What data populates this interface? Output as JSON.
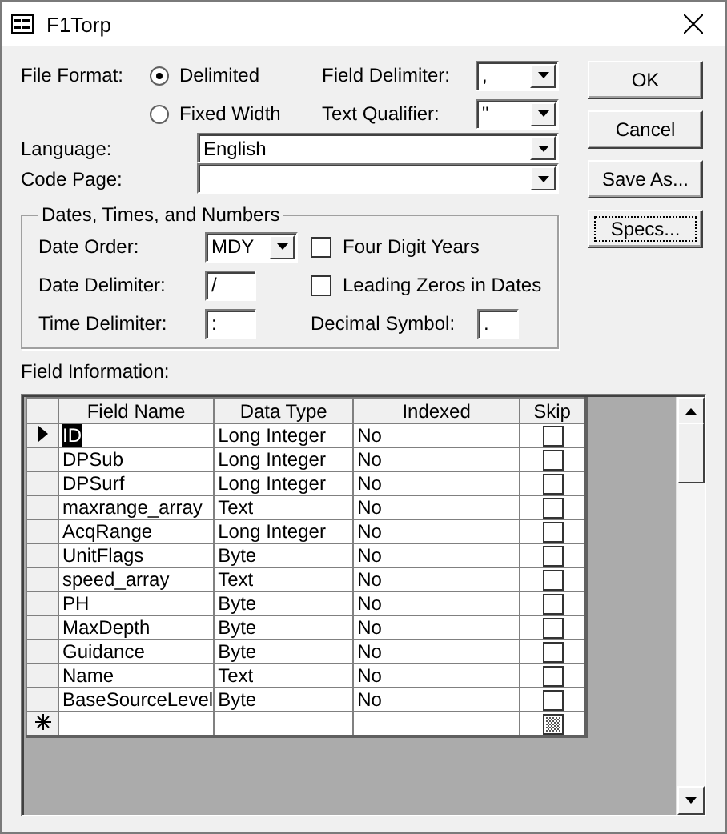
{
  "window": {
    "title": "F1Torp"
  },
  "file_format": {
    "label": "File Format:",
    "options": [
      {
        "label": "Delimited",
        "selected": true
      },
      {
        "label": "Fixed Width",
        "selected": false
      }
    ]
  },
  "field_delimiter": {
    "label": "Field Delimiter:",
    "value": ","
  },
  "text_qualifier": {
    "label": "Text Qualifier:",
    "value": "\""
  },
  "language": {
    "label": "Language:",
    "value": "English"
  },
  "code_page": {
    "label": "Code Page:"
  },
  "dates_group": {
    "title": "Dates, Times, and Numbers",
    "date_order": {
      "label": "Date Order:",
      "value": "MDY"
    },
    "date_delimiter": {
      "label": "Date Delimiter:",
      "value": "/"
    },
    "time_delimiter": {
      "label": "Time Delimiter:",
      "value": ":"
    },
    "four_digit_years": {
      "label": "Four Digit Years",
      "checked": false
    },
    "leading_zeros": {
      "label": "Leading Zeros in Dates",
      "checked": false
    },
    "decimal_symbol": {
      "label": "Decimal Symbol:",
      "value": "."
    }
  },
  "buttons": [
    {
      "label": "OK",
      "focused": false
    },
    {
      "label": "Cancel",
      "focused": false
    },
    {
      "label": "Save As...",
      "focused": false
    },
    {
      "label": "Specs...",
      "focused": true
    }
  ],
  "field_information": {
    "label": "Field Information:",
    "columns": [
      "Field Name",
      "Data Type",
      "Indexed",
      "Skip"
    ],
    "rows": [
      {
        "field_name": "ID",
        "data_type": "Long Integer",
        "indexed": "No",
        "skip": false,
        "selected": true
      },
      {
        "field_name": "DPSub",
        "data_type": "Long Integer",
        "indexed": "No",
        "skip": false,
        "selected": false
      },
      {
        "field_name": "DPSurf",
        "data_type": "Long Integer",
        "indexed": "No",
        "skip": false,
        "selected": false
      },
      {
        "field_name": "maxrange_array",
        "data_type": "Text",
        "indexed": "No",
        "skip": false,
        "selected": false
      },
      {
        "field_name": "AcqRange",
        "data_type": "Long Integer",
        "indexed": "No",
        "skip": false,
        "selected": false
      },
      {
        "field_name": "UnitFlags",
        "data_type": "Byte",
        "indexed": "No",
        "skip": false,
        "selected": false
      },
      {
        "field_name": "speed_array",
        "data_type": "Text",
        "indexed": "No",
        "skip": false,
        "selected": false
      },
      {
        "field_name": "PH",
        "data_type": "Byte",
        "indexed": "No",
        "skip": false,
        "selected": false
      },
      {
        "field_name": "MaxDepth",
        "data_type": "Byte",
        "indexed": "No",
        "skip": false,
        "selected": false
      },
      {
        "field_name": "Guidance",
        "data_type": "Byte",
        "indexed": "No",
        "skip": false,
        "selected": false
      },
      {
        "field_name": "Name",
        "data_type": "Text",
        "indexed": "No",
        "skip": false,
        "selected": false
      },
      {
        "field_name": "BaseSourceLevel",
        "data_type": "Byte",
        "indexed": "No",
        "skip": false,
        "selected": false
      }
    ]
  }
}
